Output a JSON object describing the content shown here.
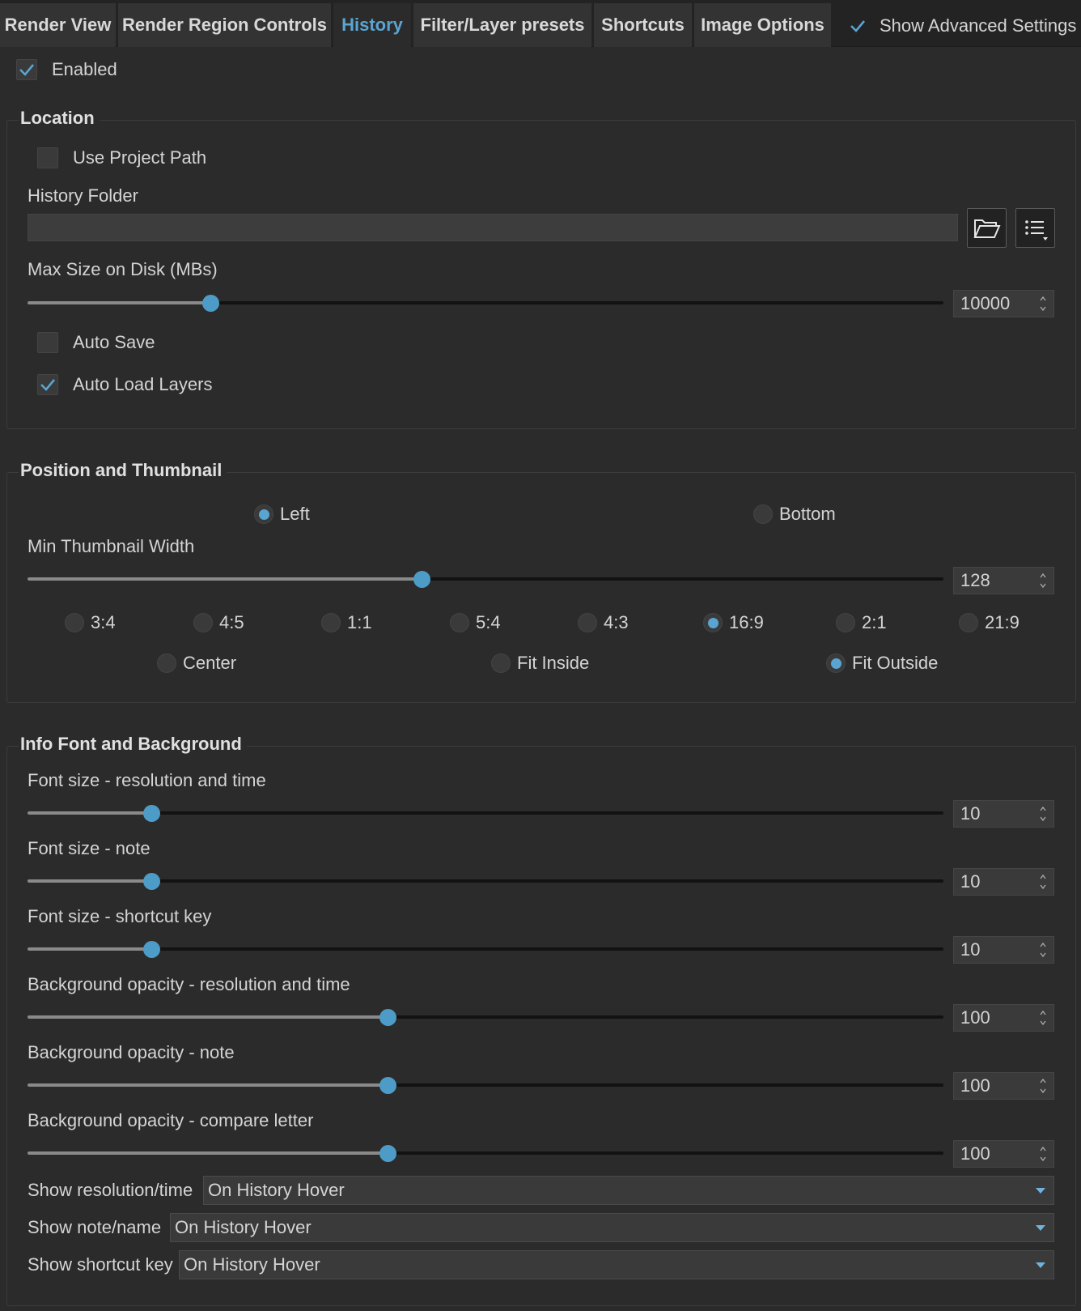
{
  "tabs": [
    {
      "label": "Render View",
      "active": false
    },
    {
      "label": "Render Region Controls",
      "active": false
    },
    {
      "label": "History",
      "active": true
    },
    {
      "label": "Filter/Layer presets",
      "active": false
    },
    {
      "label": "Shortcuts",
      "active": false
    },
    {
      "label": "Image Options",
      "active": false
    }
  ],
  "show_advanced": {
    "label": "Show Advanced Settings",
    "checked": true
  },
  "enabled": {
    "label": "Enabled",
    "checked": true
  },
  "location": {
    "title": "Location",
    "use_project_path": {
      "label": "Use Project Path",
      "checked": false
    },
    "history_folder_label": "History Folder",
    "history_folder_value": "",
    "browse_icon": "folder-open-icon",
    "menu_icon": "list-menu-icon",
    "max_size_label": "Max Size on Disk (MBs)",
    "max_size_value": "10000",
    "max_size_level": 0.2,
    "auto_save": {
      "label": "Auto Save",
      "checked": false
    },
    "auto_load_layers": {
      "label": "Auto Load Layers",
      "checked": true
    }
  },
  "position": {
    "title": "Position and Thumbnail",
    "placement": [
      {
        "label": "Left",
        "selected": true
      },
      {
        "label": "Bottom",
        "selected": false
      }
    ],
    "min_width_label": "Min Thumbnail Width",
    "min_width_value": "128",
    "min_width_level": 0.43,
    "aspects": [
      {
        "label": "3:4",
        "selected": false
      },
      {
        "label": "4:5",
        "selected": false
      },
      {
        "label": "1:1",
        "selected": false
      },
      {
        "label": "5:4",
        "selected": false
      },
      {
        "label": "4:3",
        "selected": false
      },
      {
        "label": "16:9",
        "selected": true
      },
      {
        "label": "2:1",
        "selected": false
      },
      {
        "label": "21:9",
        "selected": false
      }
    ],
    "fit": [
      {
        "label": "Center",
        "selected": false
      },
      {
        "label": "Fit Inside",
        "selected": false
      },
      {
        "label": "Fit Outside",
        "selected": true
      }
    ]
  },
  "info": {
    "title": "Info Font and Background",
    "sliders": [
      {
        "label": "Font size - resolution and time",
        "value": "10",
        "level": 0.135
      },
      {
        "label": "Font size - note",
        "value": "10",
        "level": 0.135
      },
      {
        "label": "Font size - shortcut key",
        "value": "10",
        "level": 0.135
      },
      {
        "label": "Background opacity - resolution and time",
        "value": "100",
        "level": 0.393
      },
      {
        "label": "Background opacity - note",
        "value": "100",
        "level": 0.393
      },
      {
        "label": "Background opacity - compare letter",
        "value": "100",
        "level": 0.393
      }
    ],
    "combos": [
      {
        "label": "Show resolution/time",
        "value": "On History Hover"
      },
      {
        "label": "Show note/name",
        "value": "On History Hover"
      },
      {
        "label": "Show shortcut key",
        "value": "On History Hover"
      }
    ]
  },
  "colors": {
    "accent": "#5aa4d2",
    "thumb": "#4d9cc8",
    "background": "#2b2b2b"
  }
}
